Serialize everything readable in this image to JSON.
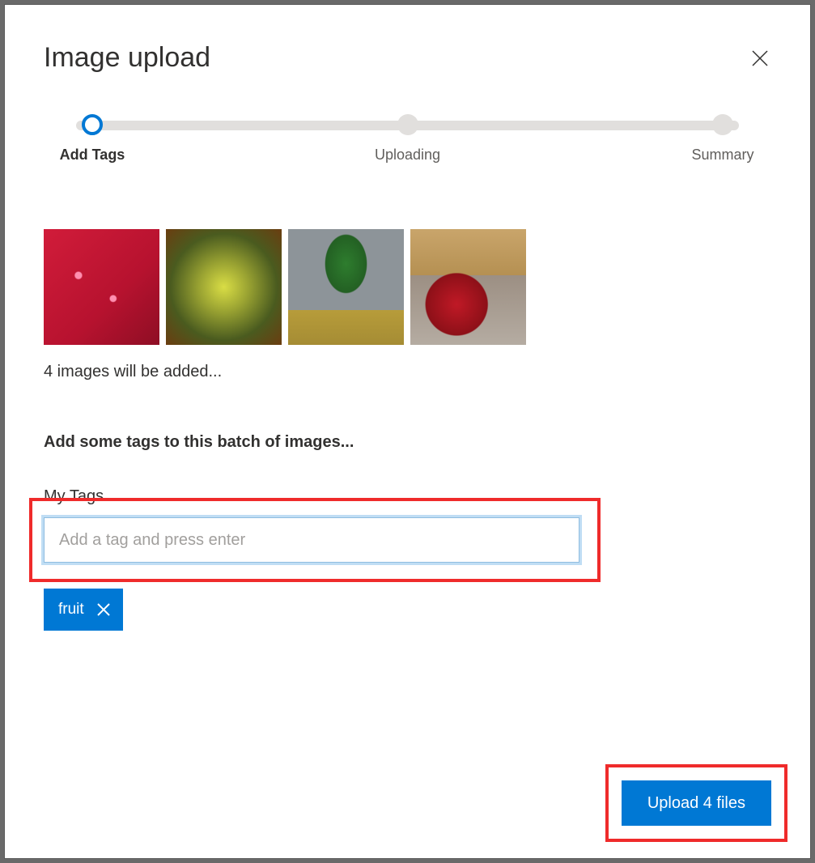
{
  "dialog": {
    "title": "Image upload"
  },
  "stepper": {
    "steps": [
      {
        "label": "Add Tags",
        "active": true
      },
      {
        "label": "Uploading",
        "active": false
      },
      {
        "label": "Summary",
        "active": false
      }
    ]
  },
  "thumbnails": {
    "count": 4,
    "status_text": "4 images will be added..."
  },
  "tags": {
    "heading": "Add some tags to this batch of images...",
    "label": "My Tags",
    "input_placeholder": "Add a tag and press enter",
    "input_value": "",
    "pills": [
      {
        "text": "fruit"
      }
    ]
  },
  "footer": {
    "upload_label": "Upload 4 files"
  }
}
